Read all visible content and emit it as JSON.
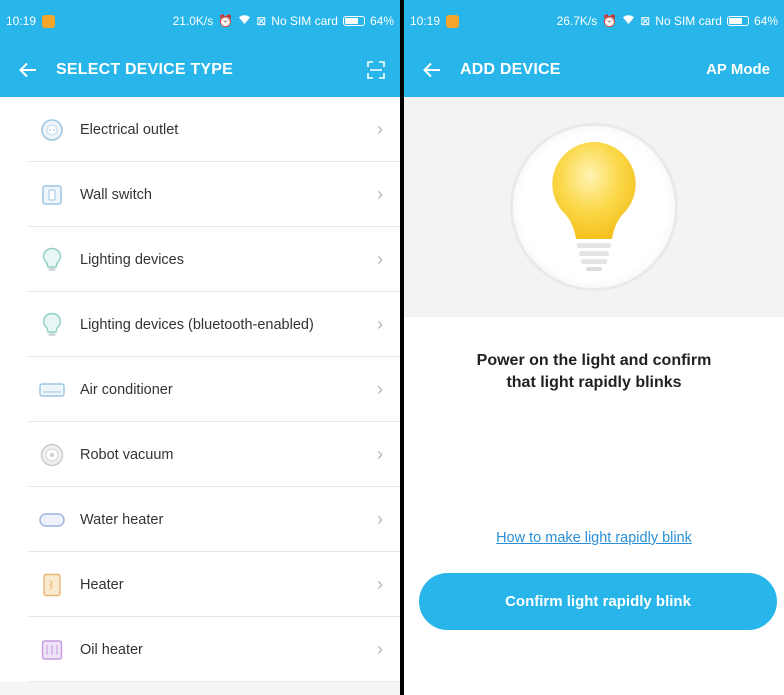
{
  "left_screen": {
    "status": {
      "time": "10:19",
      "speed": "21.0K/s",
      "sim": "No SIM card",
      "battery": "64%"
    },
    "appbar": {
      "back_icon": "arrow-left-icon",
      "title": "SELECT DEVICE TYPE",
      "action_icon": "scan-icon"
    },
    "devices": [
      {
        "label": "Electrical outlet",
        "icon": "outlet-icon"
      },
      {
        "label": "Wall switch",
        "icon": "wall-switch-icon"
      },
      {
        "label": "Lighting devices",
        "icon": "bulb-icon"
      },
      {
        "label": "Lighting devices (bluetooth-enabled)",
        "icon": "bulb-icon"
      },
      {
        "label": "Air conditioner",
        "icon": "air-conditioner-icon"
      },
      {
        "label": "Robot vacuum",
        "icon": "robot-vacuum-icon"
      },
      {
        "label": "Water heater",
        "icon": "water-heater-icon"
      },
      {
        "label": "Heater",
        "icon": "heater-icon"
      },
      {
        "label": "Oil heater",
        "icon": "oil-heater-icon"
      }
    ]
  },
  "right_screen": {
    "status": {
      "time": "10:19",
      "speed": "26.7K/s",
      "sim": "No SIM card",
      "battery": "64%"
    },
    "appbar": {
      "back_icon": "arrow-left-icon",
      "title": "ADD DEVICE",
      "action_label": "AP Mode"
    },
    "instruction_line1": "Power on the light and confirm",
    "instruction_line2": "that light rapidly blinks",
    "help_link": "How to make light rapidly blink",
    "confirm_label": "Confirm light rapidly blink"
  },
  "colors": {
    "accent": "#27b5ea",
    "link": "#2a8fd8",
    "bulb": "#fbd13b"
  }
}
